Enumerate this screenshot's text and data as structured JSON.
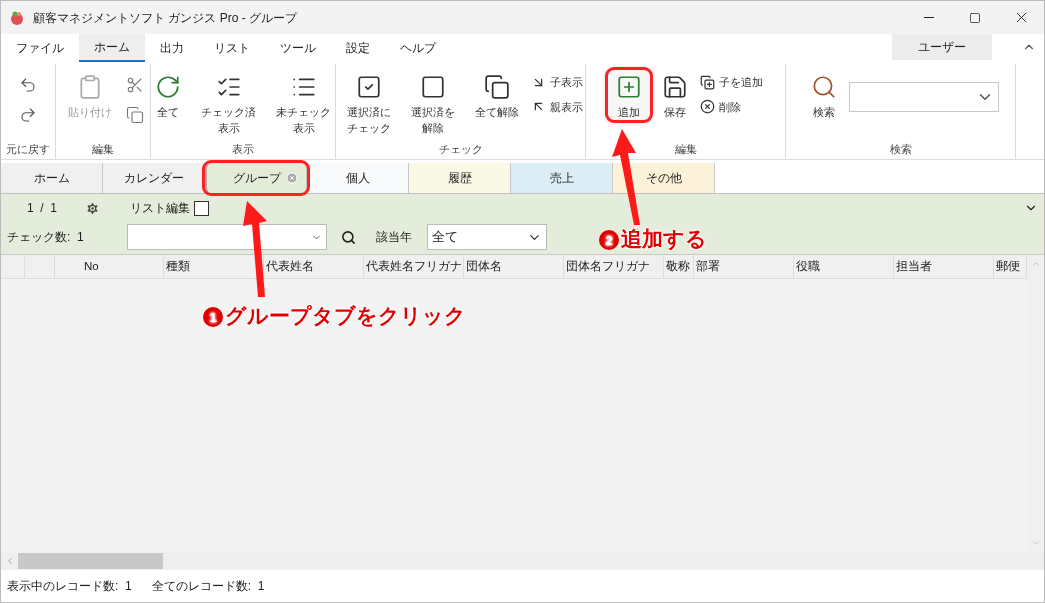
{
  "window": {
    "title": "顧客マネジメントソフト ガンジス Pro - グループ"
  },
  "menu_tabs": [
    {
      "label": "ファイル",
      "selected": false
    },
    {
      "label": "ホーム",
      "selected": true
    },
    {
      "label": "出力",
      "selected": false
    },
    {
      "label": "リスト",
      "selected": false
    },
    {
      "label": "ツール",
      "selected": false
    },
    {
      "label": "設定",
      "selected": false
    },
    {
      "label": "ヘルプ",
      "selected": false
    }
  ],
  "user_button": "ユーザー",
  "ribbon": [
    {
      "label": "元に戻す",
      "items": [
        {
          "kind": "icon-only",
          "disabled": false
        },
        {
          "kind": "icon-only",
          "disabled": false
        }
      ]
    },
    {
      "label": "編集",
      "items": [
        {
          "kind": "large",
          "label": "貼り付け",
          "disabled": true,
          "highlighted": false
        },
        {
          "kind": "icon-only",
          "disabled": false
        },
        {
          "kind": "icon-only",
          "disabled": false
        }
      ]
    },
    {
      "label": "表示",
      "items": [
        {
          "kind": "large",
          "label": "全て",
          "disabled": false,
          "highlighted": false
        },
        {
          "kind": "large",
          "lines": [
            "チェック済",
            "表示"
          ],
          "disabled": false,
          "highlighted": false
        },
        {
          "kind": "large",
          "lines": [
            "未チェック",
            "表示"
          ],
          "disabled": false,
          "highlighted": false
        }
      ]
    },
    {
      "label": "チェック",
      "items": [
        {
          "kind": "large",
          "lines": [
            "選択済に",
            "チェック"
          ],
          "disabled": false,
          "highlighted": false
        },
        {
          "kind": "large",
          "lines": [
            "選択済を",
            "解除"
          ],
          "disabled": false,
          "highlighted": false
        },
        {
          "kind": "large",
          "label": "全て解除",
          "disabled": false,
          "highlighted": false
        },
        {
          "kind": "small",
          "label": "子表示",
          "disabled": false
        },
        {
          "kind": "small",
          "label": "親表示",
          "disabled": false
        }
      ]
    },
    {
      "label": "編集",
      "items": [
        {
          "kind": "large",
          "label": "追加",
          "disabled": false,
          "highlighted": true
        },
        {
          "kind": "large",
          "label": "保存",
          "disabled": false,
          "highlighted": false
        },
        {
          "kind": "small",
          "label": "子を追加",
          "disabled": false
        },
        {
          "kind": "small",
          "label": "削除",
          "disabled": false
        }
      ]
    },
    {
      "label": "検索",
      "items": [
        {
          "kind": "large",
          "label": "検索",
          "disabled": false,
          "highlighted": false
        },
        {
          "kind": "combo"
        }
      ]
    }
  ],
  "doc_tabs": [
    {
      "label": "ホーム",
      "color": "#f0f0f0",
      "selected": false,
      "closable": false,
      "highlighted": false
    },
    {
      "label": "カレンダー",
      "color": "#f0f0f0",
      "selected": false,
      "closable": false,
      "highlighted": false
    },
    {
      "label": "グループ",
      "color": "#e3ecd9",
      "selected": true,
      "closable": true,
      "highlighted": true
    },
    {
      "label": "個人",
      "color": "#f7f9fb",
      "selected": false,
      "closable": false,
      "highlighted": false
    },
    {
      "label": "履歴",
      "color": "#f9f9e6",
      "selected": false,
      "closable": false,
      "highlighted": false
    },
    {
      "label": "売上",
      "color": "#ddedf5",
      "selected": false,
      "closable": false,
      "highlighted": false
    },
    {
      "label": "その他",
      "color": "#fcf2d9",
      "selected": false,
      "closable": false,
      "highlighted": false
    }
  ],
  "filter": {
    "page": "1  /  1",
    "list_edit": {
      "label": "リスト編集",
      "checked": false
    },
    "check_count": "チェック数:  1",
    "year_label": "該当年",
    "year_value": "全て"
  },
  "table": {
    "columns": [
      "No",
      "種類",
      "代表姓名",
      "代表姓名フリガナ",
      "団体名",
      "団体名フリガナ",
      "敬称",
      "部署",
      "役職",
      "担当者",
      "郵便"
    ]
  },
  "status_bar": [
    "表示中のレコード数:  1",
    "全てのレコード数:  1"
  ],
  "annotations": [
    {
      "number": "1",
      "text": "グループタブをクリック"
    },
    {
      "number": "2",
      "text": "追加する"
    }
  ]
}
